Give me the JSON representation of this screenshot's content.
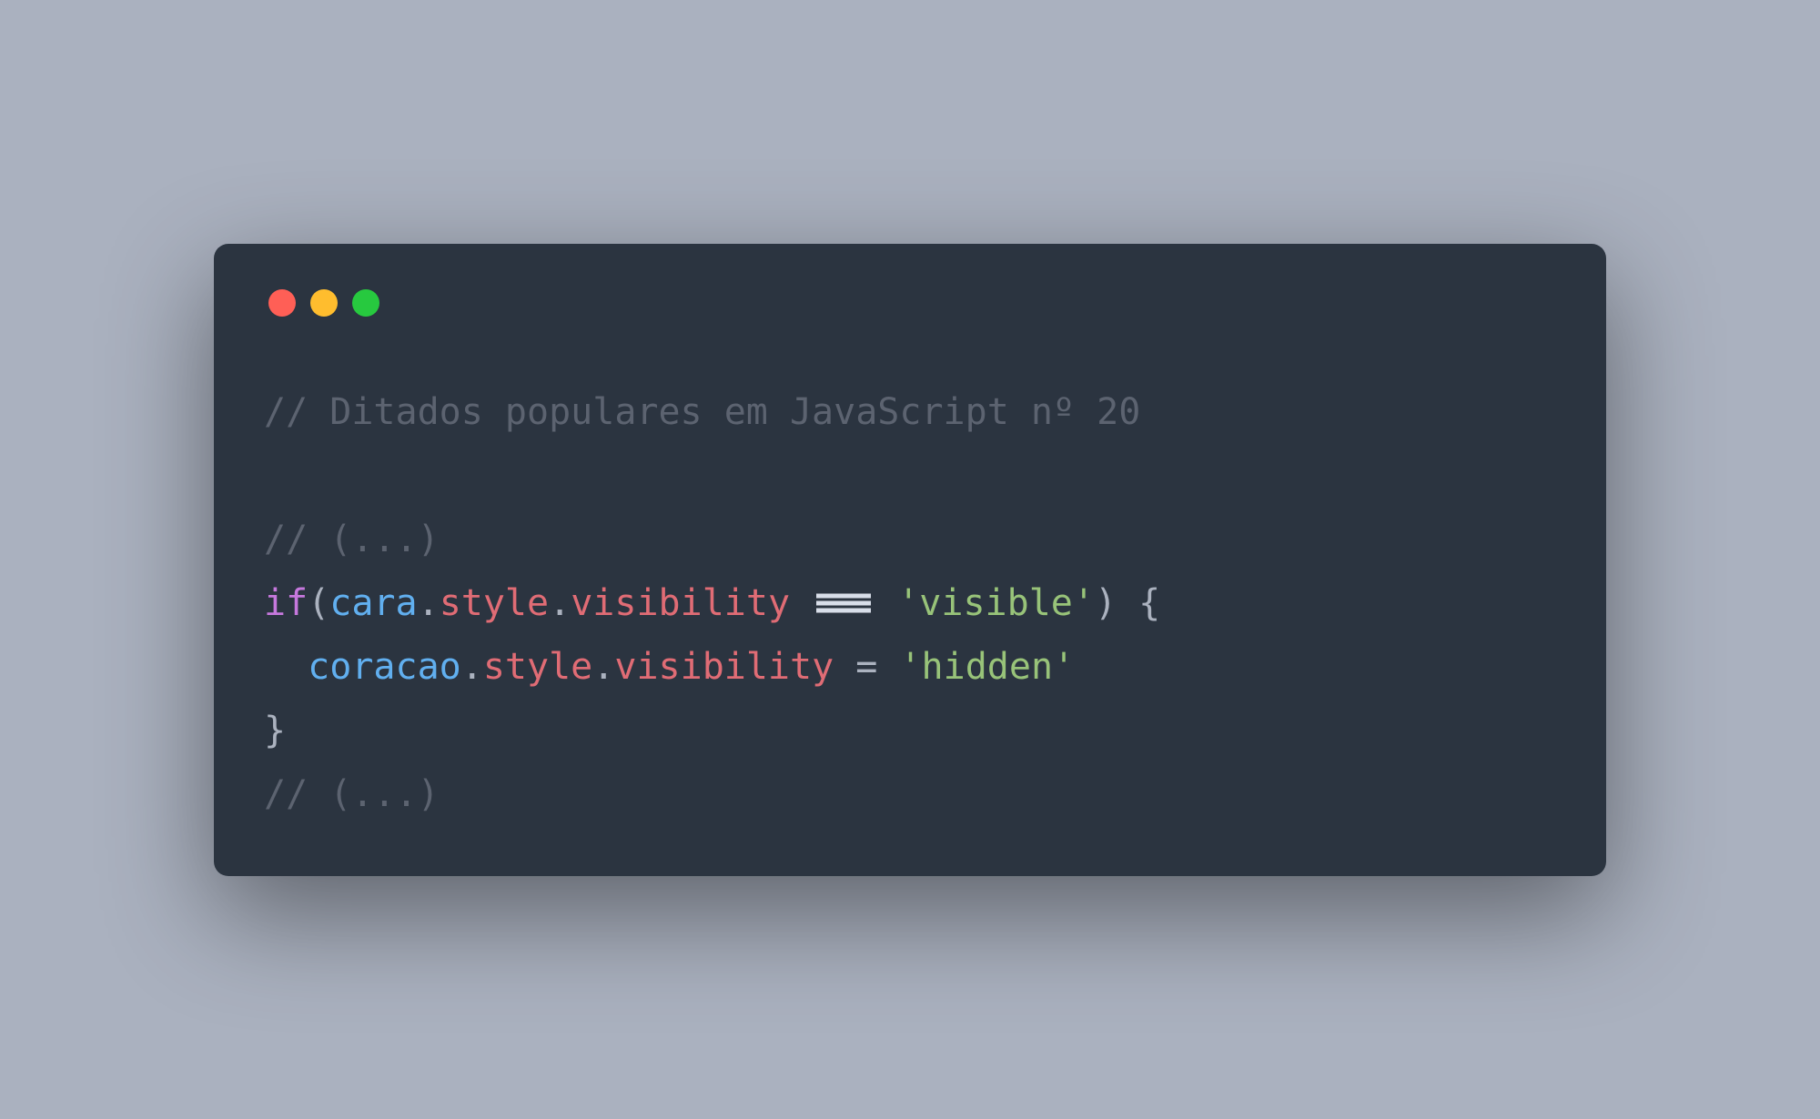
{
  "colors": {
    "background": "#aab1bf",
    "window": "#2b3440",
    "traffic_red": "#ff5f56",
    "traffic_yellow": "#ffbd2e",
    "traffic_green": "#27c93f",
    "comment": "#5c6370",
    "keyword": "#c678dd",
    "variable": "#61afef",
    "property": "#e06c75",
    "string": "#98c379",
    "default": "#abb2bf"
  },
  "code": {
    "line1_comment": "// Ditados populares em JavaScript nº 20",
    "blank": "",
    "line3_comment": "// (...)",
    "line4": {
      "kw_if": "if",
      "paren_open": "(",
      "var_cara": "cara",
      "dot1": ".",
      "prop_style1": "style",
      "dot2": ".",
      "prop_visibility1": "visibility",
      "sp1": " ",
      "strict_eq": "===",
      "sp2": " ",
      "str_visible": "'visible'",
      "paren_close": ")",
      "sp3": " ",
      "brace_open": "{"
    },
    "line5": {
      "indent": "  ",
      "var_coracao": "coracao",
      "dot3": ".",
      "prop_style2": "style",
      "dot4": ".",
      "prop_visibility2": "visibility",
      "sp4": " ",
      "assign": "=",
      "sp5": " ",
      "str_hidden": "'hidden'"
    },
    "line6_brace_close": "}",
    "line7_comment": "// (...)"
  }
}
